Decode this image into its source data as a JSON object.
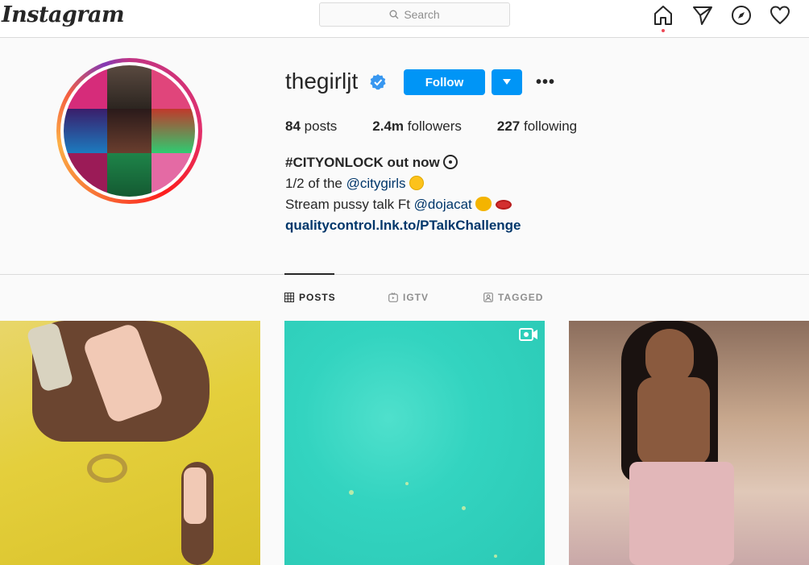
{
  "nav": {
    "logo": "Instagram",
    "search_placeholder": "Search",
    "icons": [
      "home-icon",
      "direct-icon",
      "explore-icon",
      "activity-heart-icon"
    ]
  },
  "profile": {
    "username": "thegirljt",
    "verified": true,
    "follow_label": "Follow",
    "more_label": "•••",
    "stats": {
      "posts_count": "84",
      "posts_label": "posts",
      "followers_count": "2.4m",
      "followers_label": "followers",
      "following_count": "227",
      "following_label": "following"
    },
    "bio": {
      "line1": "#CITYONLOCK out now",
      "line2_prefix": "1/2 of the ",
      "line2_mention": "@citygirls",
      "line3_prefix": "Stream pussy talk Ft ",
      "line3_mention": "@dojacat",
      "link": "qualitycontrol.lnk.to/PTalkChallenge"
    }
  },
  "tabs": [
    {
      "label": "POSTS",
      "active": true
    },
    {
      "label": "IGTV",
      "active": false
    },
    {
      "label": "TAGGED",
      "active": false
    }
  ],
  "colors": {
    "accent": "#0095f6",
    "link": "#00376b",
    "text": "#262626",
    "muted": "#8e8e8e",
    "border": "#dbdbdb",
    "background": "#fafafa"
  }
}
